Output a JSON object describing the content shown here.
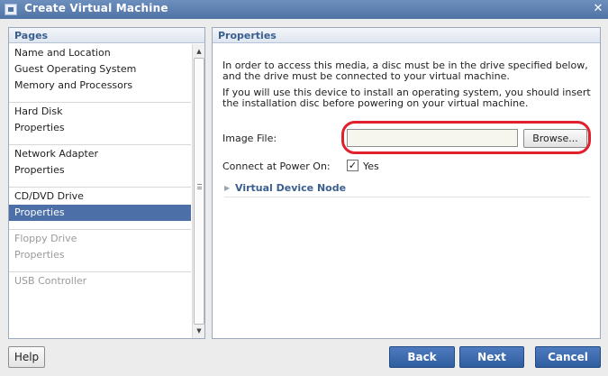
{
  "window": {
    "title": "Create Virtual Machine",
    "close_glyph": "✕"
  },
  "pages_panel": {
    "header": "Pages",
    "groups": [
      {
        "items": [
          {
            "label": "Name and Location",
            "state": "normal"
          },
          {
            "label": "Guest Operating System",
            "state": "normal"
          },
          {
            "label": "Memory and Processors",
            "state": "normal"
          }
        ]
      },
      {
        "items": [
          {
            "label": "Hard Disk",
            "state": "normal"
          },
          {
            "label": "Properties",
            "state": "normal"
          }
        ]
      },
      {
        "items": [
          {
            "label": "Network Adapter",
            "state": "normal"
          },
          {
            "label": "Properties",
            "state": "normal"
          }
        ]
      },
      {
        "items": [
          {
            "label": "CD/DVD Drive",
            "state": "normal"
          },
          {
            "label": "Properties",
            "state": "selected"
          }
        ]
      },
      {
        "items": [
          {
            "label": "Floppy Drive",
            "state": "disabled"
          },
          {
            "label": "Properties",
            "state": "disabled"
          }
        ]
      },
      {
        "items": [
          {
            "label": "USB Controller",
            "state": "disabled"
          }
        ]
      }
    ]
  },
  "properties_panel": {
    "header": "Properties",
    "paragraph1": "In order to access this media, a disc must be in the drive specified below, and the drive must be connected to your virtual machine.",
    "paragraph2": "If you will use this device to install an operating system, you should insert the installation disc before powering on your virtual machine.",
    "image_file": {
      "label": "Image File:",
      "value": "",
      "browse_label": "Browse..."
    },
    "connect_at_power_on": {
      "label": "Connect at Power On:",
      "checked": true,
      "check_glyph": "✓",
      "option_label": "Yes"
    },
    "virtual_device_node": {
      "label": "Virtual Device Node",
      "expanded": false,
      "arrow_glyph": "▶"
    }
  },
  "footer": {
    "help_label": "Help",
    "back_label": "Back",
    "next_label": "Next",
    "cancel_label": "Cancel"
  },
  "colors": {
    "title_bar": "#5a7eb2",
    "accent": "#3a5f8f",
    "selection": "#4d6fa8",
    "highlight_ring": "#e0202c",
    "primary_button": "#3b6aaf"
  },
  "icons": {
    "app_icon": "virtual-machine-icon",
    "close": "close-icon",
    "scroll_up": "scroll-up-arrow-icon",
    "scroll_down": "scroll-down-arrow-icon",
    "expand": "triangle-right-icon"
  }
}
